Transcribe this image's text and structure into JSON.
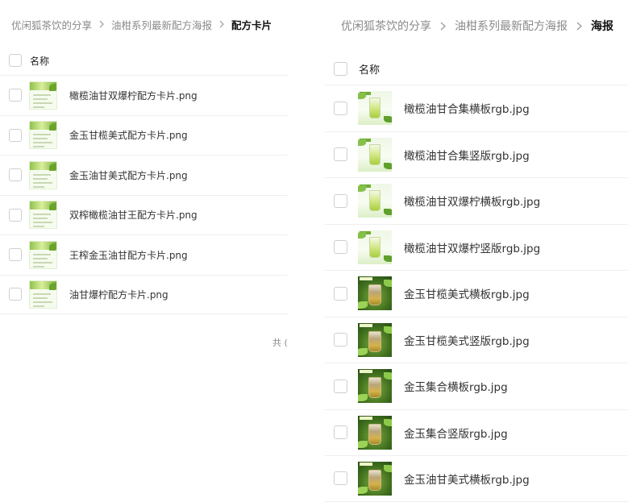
{
  "left_panel": {
    "breadcrumb": {
      "items": [
        "优闲狐茶饮的分享",
        "油柑系列最新配方海报"
      ],
      "current": "配方卡片"
    },
    "header": {
      "name_label": "名称"
    },
    "files": [
      {
        "name": "橄榄油甘双爆柠配方卡片.png"
      },
      {
        "name": "金玉甘榄美式配方卡片.png"
      },
      {
        "name": "金玉油甘美式配方卡片.png"
      },
      {
        "name": "双榨橄榄油甘王配方卡片.png"
      },
      {
        "name": "王榨金玉油甘配方卡片.png"
      },
      {
        "name": "油甘爆柠配方卡片.png"
      }
    ],
    "footer": {
      "count_text": "共 ("
    }
  },
  "right_panel": {
    "breadcrumb": {
      "items": [
        "优闲狐茶饮的分享",
        "油柑系列最新配方海报"
      ],
      "current": "海报"
    },
    "header": {
      "name_label": "名称"
    },
    "files": [
      {
        "name": "橄榄油甘合集横板rgb.jpg",
        "thumb": "light"
      },
      {
        "name": "橄榄油甘合集竖版rgb.jpg",
        "thumb": "light"
      },
      {
        "name": "橄榄油甘双爆柠横板rgb.jpg",
        "thumb": "light"
      },
      {
        "name": "橄榄油甘双爆柠竖版rgb.jpg",
        "thumb": "light"
      },
      {
        "name": "金玉甘榄美式横板rgb.jpg",
        "thumb": "dark"
      },
      {
        "name": "金玉甘榄美式竖版rgb.jpg",
        "thumb": "dark"
      },
      {
        "name": "金玉集合横板rgb.jpg",
        "thumb": "dark"
      },
      {
        "name": "金玉集合竖版rgb.jpg",
        "thumb": "dark"
      },
      {
        "name": "金玉油甘美式横板rgb.jpg",
        "thumb": "dark"
      }
    ]
  },
  "icons": {
    "breadcrumb_separator": "chevron-right-icon",
    "file_thumbnail": "image-thumbnail-icon",
    "checkbox": "checkbox-icon"
  },
  "colors": {
    "text_primary": "#333333",
    "text_muted": "#8a8a8a",
    "breadcrumb_current": "#111111",
    "divider": "#efefef",
    "checkbox_border": "#cfcfcf"
  }
}
